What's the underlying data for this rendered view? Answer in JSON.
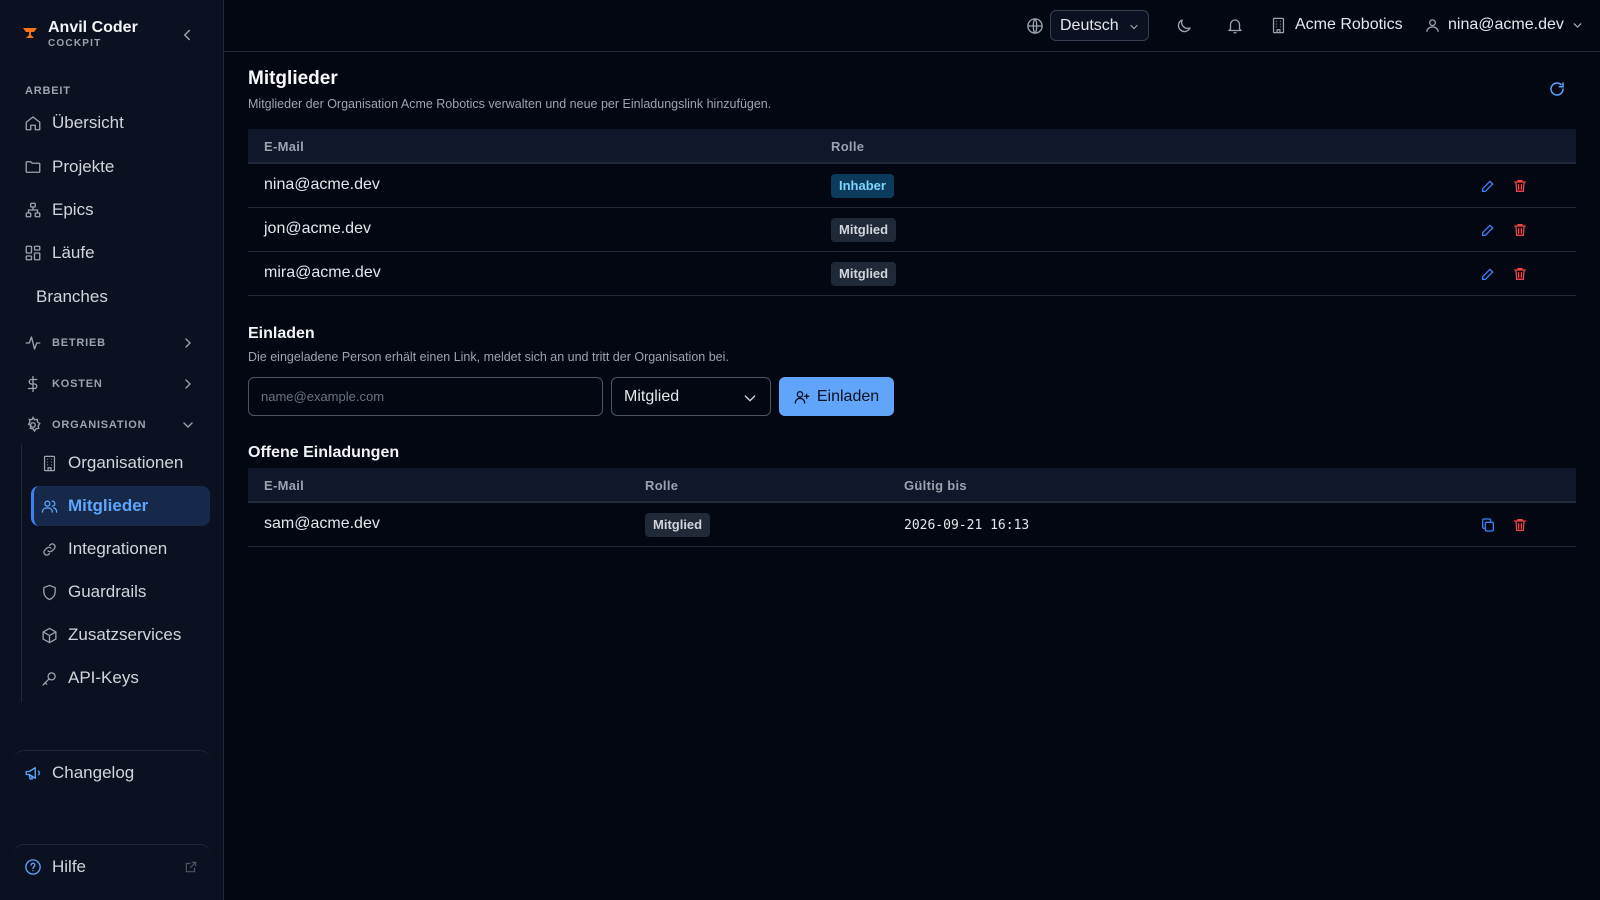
{
  "brand": {
    "name": "Anvil Coder",
    "subtitle": "COCKPIT"
  },
  "sidebar": {
    "section_work": "ARBEIT",
    "items": [
      {
        "label": "Übersicht",
        "icon": "home-icon"
      },
      {
        "label": "Projekte",
        "icon": "folder-icon"
      },
      {
        "label": "Epics",
        "icon": "hierarchy-icon"
      },
      {
        "label": "Läufe",
        "icon": "layout-grid-icon"
      },
      {
        "label": "Branches",
        "icon": ""
      }
    ],
    "groups": [
      {
        "label": "BETRIEB",
        "icon": "activity-icon"
      },
      {
        "label": "KOSTEN",
        "icon": "dollar-icon"
      },
      {
        "label": "ORGANISATION",
        "icon": "gear-icon"
      }
    ],
    "org_items": [
      {
        "label": "Organisationen",
        "icon": "building-icon"
      },
      {
        "label": "Mitglieder",
        "icon": "users-icon"
      },
      {
        "label": "Integrationen",
        "icon": "link-icon"
      },
      {
        "label": "Guardrails",
        "icon": "shield-icon"
      },
      {
        "label": "Zusatzservices",
        "icon": "package-icon"
      },
      {
        "label": "API-Keys",
        "icon": "key-icon"
      }
    ],
    "changelog": "Changelog",
    "help": "Hilfe"
  },
  "topbar": {
    "language": "Deutsch",
    "organization": "Acme Robotics",
    "user": "nina@acme.dev"
  },
  "main": {
    "title": "Mitglieder",
    "subtitle": "Mitglieder der Organisation Acme Robotics verwalten und neue per Einladungslink hinzufügen.",
    "members_table": {
      "headers": {
        "email": "E-Mail",
        "role": "Rolle"
      },
      "rows": [
        {
          "email": "nina@acme.dev",
          "role": "Inhaber"
        },
        {
          "email": "jon@acme.dev",
          "role": "Mitglied"
        },
        {
          "email": "mira@acme.dev",
          "role": "Mitglied"
        }
      ]
    },
    "invite": {
      "title": "Einladen",
      "description": "Die eingeladene Person erhält einen Link, meldet sich an und tritt der Organisation bei.",
      "email_placeholder": "name@example.com",
      "email_value": "",
      "role_selected": "Mitglied",
      "button_label": "Einladen"
    },
    "pending": {
      "title": "Offene Einladungen",
      "headers": {
        "email": "E-Mail",
        "role": "Rolle",
        "valid_until": "Gültig bis"
      },
      "rows": [
        {
          "email": "sam@acme.dev",
          "role": "Mitglied",
          "valid_until": "2026-09-21 16:13"
        }
      ]
    }
  },
  "colors": {
    "accent": "#60a5fa",
    "background": "#030712",
    "sidebar": "#0b1120",
    "danger": "#ef4444",
    "owner_badge": "#0c3a5a"
  }
}
